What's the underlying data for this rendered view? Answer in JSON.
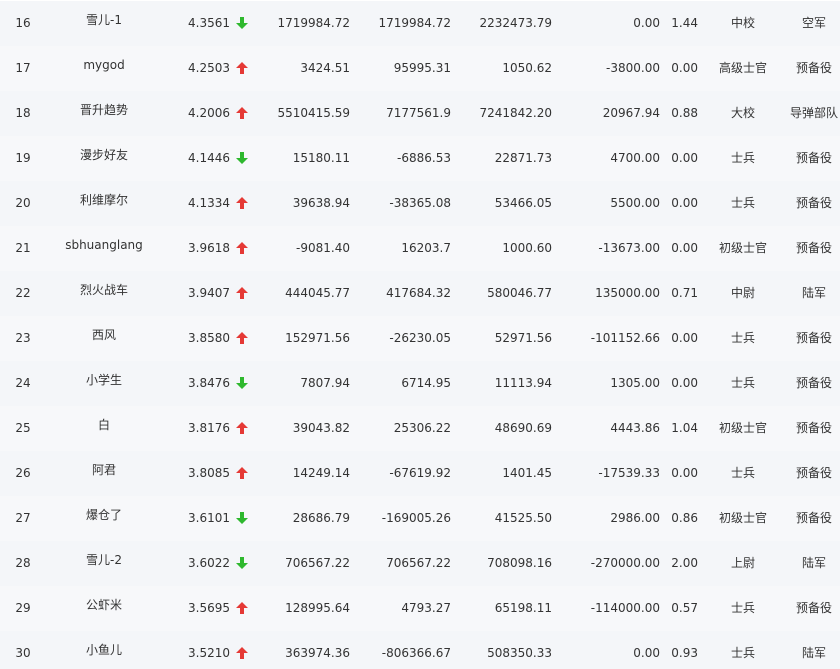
{
  "colors": {
    "up_arrow": "#e53935",
    "down_arrow": "#2eb82e",
    "text": "#333333"
  },
  "rows": [
    {
      "rank": "16",
      "name": "雪儿-1",
      "score": "4.3561",
      "trend": "down",
      "v1": "1719984.72",
      "v2": "1719984.72",
      "v3": "2232473.79",
      "v4": "0.00",
      "ratio": "1.44",
      "rank_title": "中校",
      "branch": "空军"
    },
    {
      "rank": "17",
      "name": "mygod",
      "score": "4.2503",
      "trend": "up",
      "v1": "3424.51",
      "v2": "95995.31",
      "v3": "1050.62",
      "v4": "-3800.00",
      "ratio": "0.00",
      "rank_title": "高级士官",
      "branch": "预备役"
    },
    {
      "rank": "18",
      "name": "晋升趋势",
      "score": "4.2006",
      "trend": "up",
      "v1": "5510415.59",
      "v2": "7177561.9",
      "v3": "7241842.20",
      "v4": "20967.94",
      "ratio": "0.88",
      "rank_title": "大校",
      "branch": "导弹部队"
    },
    {
      "rank": "19",
      "name": "漫步好友",
      "score": "4.1446",
      "trend": "down",
      "v1": "15180.11",
      "v2": "-6886.53",
      "v3": "22871.73",
      "v4": "4700.00",
      "ratio": "0.00",
      "rank_title": "士兵",
      "branch": "预备役"
    },
    {
      "rank": "20",
      "name": "利维摩尔",
      "score": "4.1334",
      "trend": "up",
      "v1": "39638.94",
      "v2": "-38365.08",
      "v3": "53466.05",
      "v4": "5500.00",
      "ratio": "0.00",
      "rank_title": "士兵",
      "branch": "预备役"
    },
    {
      "rank": "21",
      "name": "sbhuanglang",
      "score": "3.9618",
      "trend": "up",
      "v1": "-9081.40",
      "v2": "16203.7",
      "v3": "1000.60",
      "v4": "-13673.00",
      "ratio": "0.00",
      "rank_title": "初级士官",
      "branch": "预备役"
    },
    {
      "rank": "22",
      "name": "烈火战车",
      "score": "3.9407",
      "trend": "up",
      "v1": "444045.77",
      "v2": "417684.32",
      "v3": "580046.77",
      "v4": "135000.00",
      "ratio": "0.71",
      "rank_title": "中尉",
      "branch": "陆军"
    },
    {
      "rank": "23",
      "name": "西风",
      "score": "3.8580",
      "trend": "up",
      "v1": "152971.56",
      "v2": "-26230.05",
      "v3": "52971.56",
      "v4": "-101152.66",
      "ratio": "0.00",
      "rank_title": "士兵",
      "branch": "预备役"
    },
    {
      "rank": "24",
      "name": "小学生",
      "score": "3.8476",
      "trend": "down",
      "v1": "7807.94",
      "v2": "6714.95",
      "v3": "11113.94",
      "v4": "1305.00",
      "ratio": "0.00",
      "rank_title": "士兵",
      "branch": "预备役"
    },
    {
      "rank": "25",
      "name": "白",
      "score": "3.8176",
      "trend": "up",
      "v1": "39043.82",
      "v2": "25306.22",
      "v3": "48690.69",
      "v4": "4443.86",
      "ratio": "1.04",
      "rank_title": "初级士官",
      "branch": "预备役"
    },
    {
      "rank": "26",
      "name": "阿君",
      "score": "3.8085",
      "trend": "up",
      "v1": "14249.14",
      "v2": "-67619.92",
      "v3": "1401.45",
      "v4": "-17539.33",
      "ratio": "0.00",
      "rank_title": "士兵",
      "branch": "预备役"
    },
    {
      "rank": "27",
      "name": "爆仓了",
      "score": "3.6101",
      "trend": "down",
      "v1": "28686.79",
      "v2": "-169005.26",
      "v3": "41525.50",
      "v4": "2986.00",
      "ratio": "0.86",
      "rank_title": "初级士官",
      "branch": "预备役"
    },
    {
      "rank": "28",
      "name": "雪儿-2",
      "score": "3.6022",
      "trend": "down",
      "v1": "706567.22",
      "v2": "706567.22",
      "v3": "708098.16",
      "v4": "-270000.00",
      "ratio": "2.00",
      "rank_title": "上尉",
      "branch": "陆军"
    },
    {
      "rank": "29",
      "name": "公虾米",
      "score": "3.5695",
      "trend": "up",
      "v1": "128995.64",
      "v2": "4793.27",
      "v3": "65198.11",
      "v4": "-114000.00",
      "ratio": "0.57",
      "rank_title": "士兵",
      "branch": "预备役"
    },
    {
      "rank": "30",
      "name": "小鱼儿",
      "score": "3.5210",
      "trend": "up",
      "v1": "363974.36",
      "v2": "-806366.67",
      "v3": "508350.33",
      "v4": "0.00",
      "ratio": "0.93",
      "rank_title": "士兵",
      "branch": "陆军"
    }
  ]
}
